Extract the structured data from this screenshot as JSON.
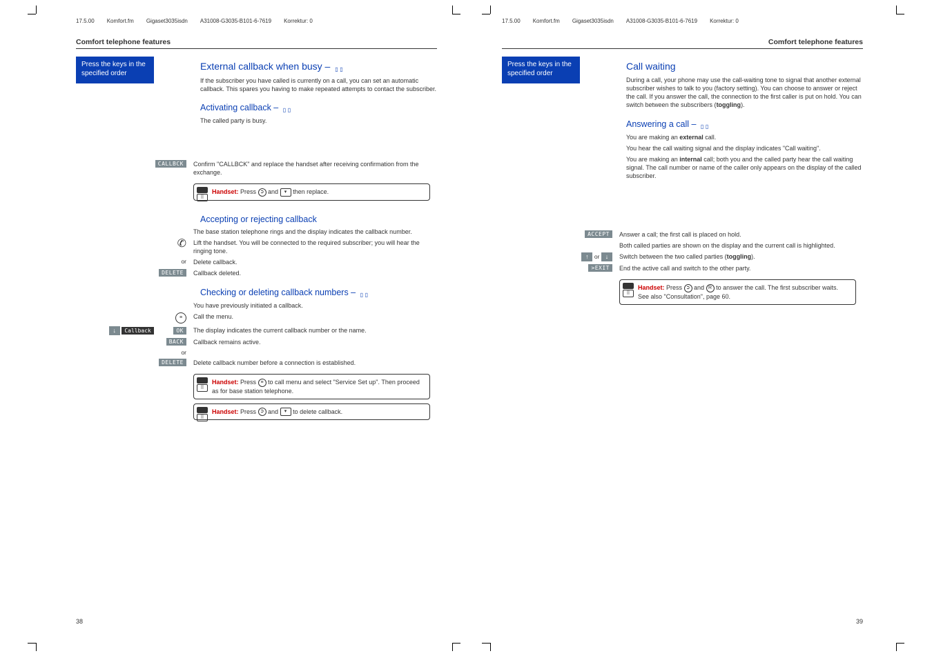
{
  "header": {
    "date": "17.5.00",
    "file": "Komfort.fm",
    "product": "Gigaset3035isdn",
    "partno": "A31008-G3035-B101-6-7619",
    "korrektur": "Korrektur: 0"
  },
  "left_page": {
    "section_title": "Comfort telephone features",
    "blue_box_l1": "Press the keys in the",
    "blue_box_l2": "specified order",
    "h1": "External callback when busy – ",
    "intro": "If the subscriber you have called is currently on a call, you can set an automatic callback. This spares you having to make repeated attempts to contact the subscriber.",
    "h2": "Activating callback – ",
    "line_busy": "The called party is busy.",
    "btn_callbck": "CALLBCK",
    "callbck_text": "Confirm \"CALLBCK\" and replace the handset after receiving confirmation from the exchange.",
    "tip1_prefix": "Handset:",
    "tip1_rest": "  Press       and       then replace.",
    "h3": "Accepting or rejecting callback",
    "accept_intro": "The base station telephone rings and the display indicates the callback number.",
    "lift_text": "Lift the handset. You will be connected to the required subscriber; you will hear the ringing tone.",
    "or1": "or",
    "delete_cb": "Delete callback.",
    "btn_delete": "DELETE",
    "deleted": "Callback deleted.",
    "h4": "Checking or deleting callback numbers – ",
    "prev_init": "You have previously initiated a callback.",
    "call_menu": "Call the menu.",
    "callback_label": "Callback",
    "btn_ok": "OK",
    "display_ind": "The display indicates the current callback number or the name.",
    "btn_back": "BACK",
    "cb_active": "Callback remains active.",
    "or2": "or",
    "btn_delete2": "DELETE",
    "del_before": "Delete callback number before a connection is established.",
    "tip2_prefix": "Handset:",
    "tip2_rest": "  Press       to call menu and select \"Service Set up\". Then proceed as for base station telephone.",
    "tip3_prefix": "Handset:",
    "tip3_rest": "  Press       and       to delete callback.",
    "page_number": "38"
  },
  "right_page": {
    "section_title": "Comfort telephone features",
    "blue_box_l1": "Press the keys in the",
    "blue_box_l2": "specified order",
    "h1": "Call waiting",
    "intro": "During a call, your phone may use the call-waiting tone to signal that another external subscriber wishes to talk to you (factory setting). You can choose to answer or reject the call. If you answer the call, the connection to the first caller is put on hold. You can switch between the subscribers (",
    "intro_bold": "toggling",
    "intro_end": ").",
    "h2": "Answering a call – ",
    "ext_call_1": "You are making an ",
    "ext_call_bold": "external",
    "ext_call_2": " call.",
    "hear_signal": "You hear the call waiting signal and the display indicates \"Call waiting\".",
    "int_call_1": "You are making an ",
    "int_call_bold": "internal",
    "int_call_2": " call; both you and the called party hear the call waiting signal. The call number or name of the caller only appears on the display of the called subscriber.",
    "btn_accept": "ACCEPT",
    "accept_text": "Answer a call; the first call is placed on hold.",
    "both_shown": "Both called parties are shown on the display and the current call is highlighted.",
    "or": "or",
    "toggle_text_1": "Switch between the two called parties (",
    "toggle_bold": "toggling",
    "toggle_text_2": ").",
    "btn_exit": ">EXIT",
    "end_active": "End the active call and switch to the other party.",
    "tip_prefix": "Handset:",
    "tip_rest": "  Press      and      to answer the call. The first subscriber waits. See also \"Consultation\", page 60.",
    "page_number": "39"
  }
}
